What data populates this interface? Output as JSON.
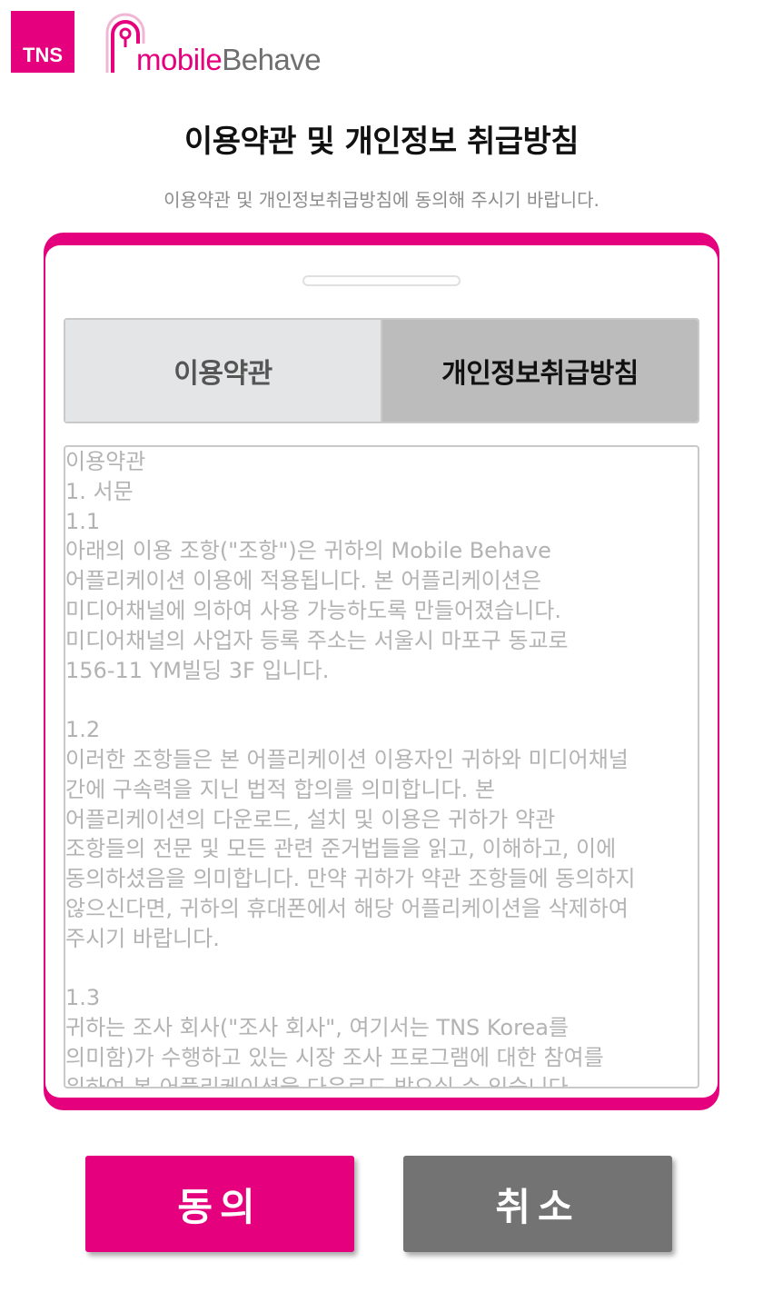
{
  "brand": {
    "tns_logo": "TNS",
    "app_logo_prefix": "mobile",
    "app_logo_suffix": "Behave",
    "accent_color": "#e5007e"
  },
  "header": {
    "title": "이용약관 및 개인정보 취급방침",
    "subtitle": "이용약관 및 개인정보취급방침에 동의해 주시기 바랍니다."
  },
  "tabs": [
    {
      "label": "이용약관",
      "selected": false
    },
    {
      "label": "개인정보취급방침",
      "selected": true
    }
  ],
  "terms": {
    "text": "이용약관\n1. 서문\n1.1\n아래의 이용 조항(\"조항\")은 귀하의 Mobile Behave\n어플리케이션 이용에 적용됩니다. 본 어플리케이션은\n미디어채널에 의하여 사용 가능하도록 만들어졌습니다.\n미디어채널의 사업자 등록 주소는 서울시 마포구 동교로\n156-11 YM빌딩 3F 입니다.\n\n1.2\n이러한 조항들은 본 어플리케이션 이용자인 귀하와 미디어채널\n간에 구속력을 지닌 법적 합의를 의미합니다. 본\n어플리케이션의 다운로드, 설치 및 이용은 귀하가 약관\n조항들의 전문 및 모든 관련 준거법들을 읽고, 이해하고, 이에\n동의하셨음을 의미합니다. 만약 귀하가 약관 조항들에 동의하지\n않으신다면, 귀하의 휴대폰에서 해당 어플리케이션을 삭제하여\n주시기 바랍니다.\n\n1.3\n귀하는 조사 회사(\"조사 회사\", 여기서는 TNS Korea를\n의미함)가 수행하고 있는 시장 조사 프로그램에 대한 참여를\n위하여 본 어플리케이션을 다운로드 받으실 수 있습니다."
  },
  "actions": {
    "agree_label": "동의",
    "cancel_label": "취소"
  }
}
